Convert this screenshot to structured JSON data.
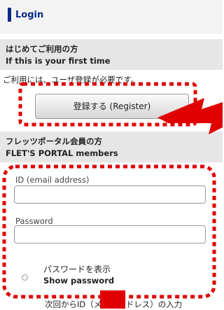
{
  "header": {
    "title": "Login"
  },
  "first_time": {
    "heading_jp": "はじめてご利用の方",
    "heading_en": "If this is your first time",
    "intro": "ご利用には、ユーザ登録が必要です。",
    "register_button": "登録する (Register)"
  },
  "members": {
    "heading_jp": "フレッツポータル会員の方",
    "heading_en": "FLET'S PORTAL members",
    "id_label": "ID (email address)",
    "password_label": "Password",
    "show_password_jp": "パスワードを表示",
    "show_password_en": "Show password",
    "footer_text": "次回からID（メールアドレス）の入力"
  },
  "colors": {
    "accent": "#0a2a8a",
    "annotation": "#e00000",
    "section_bg": "#e6e6e6"
  }
}
